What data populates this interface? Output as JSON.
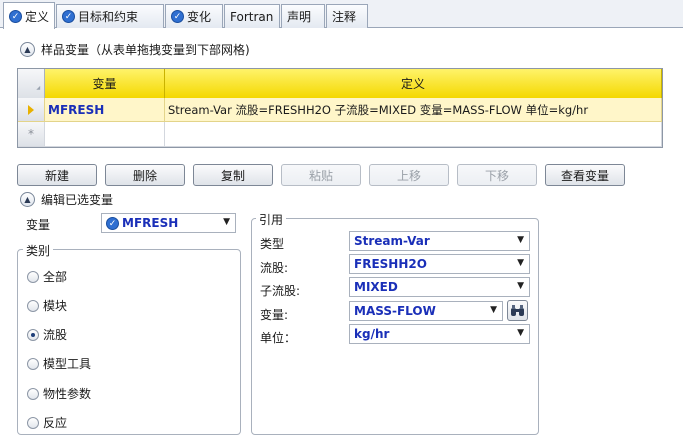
{
  "tabs": [
    {
      "label": "定义",
      "checked": true,
      "active": true
    },
    {
      "label": "目标和约束",
      "checked": true,
      "active": false
    },
    {
      "label": "变化",
      "checked": true,
      "active": false
    },
    {
      "label": "Fortran",
      "checked": false,
      "active": false
    },
    {
      "label": "声明",
      "checked": false,
      "active": false
    },
    {
      "label": "注释",
      "checked": false,
      "active": false
    }
  ],
  "sample_section": {
    "title": "样品变量（从表单拖拽变量到下部网格)"
  },
  "grid": {
    "headers": {
      "variable": "变量",
      "definition": "定义"
    },
    "rows": [
      {
        "variable": "MFRESH",
        "definition": "Stream-Var 流股=FRESHH2O 子流股=MIXED 变量=MASS-FLOW 单位=kg/hr"
      }
    ],
    "new_row_marker": "*"
  },
  "buttons": {
    "new": "新建",
    "delete": "删除",
    "copy": "复制",
    "paste": "粘贴",
    "move_up": "上移",
    "move_down": "下移",
    "view_vars": "查看变量"
  },
  "edit_section": {
    "title": "编辑已选变量"
  },
  "variable": {
    "label": "变量",
    "value": "MFRESH"
  },
  "category": {
    "title": "类别",
    "options": [
      "全部",
      "模块",
      "流股",
      "模型工具",
      "物性参数",
      "反应"
    ],
    "selected": "流股"
  },
  "reference": {
    "title": "引用",
    "type": {
      "label": "类型",
      "value": "Stream-Var"
    },
    "stream": {
      "label": "流股:",
      "value": "FRESHH2O"
    },
    "substream": {
      "label": "子流股:",
      "value": "MIXED"
    },
    "variable": {
      "label": "变量:",
      "value": "MASS-FLOW"
    },
    "units": {
      "label": "单位：",
      "value": "kg/hr"
    }
  }
}
